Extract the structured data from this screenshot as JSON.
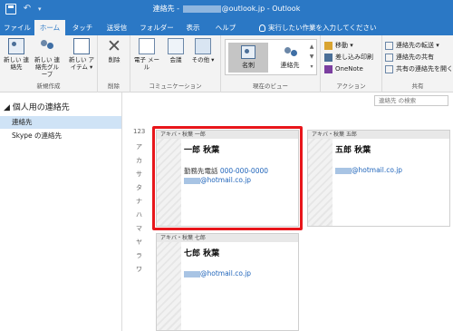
{
  "window": {
    "title_prefix": "連絡先 - ",
    "title_suffix": "@outlook.jp  -  Outlook"
  },
  "tabs": [
    {
      "label": "ファイル",
      "active": false
    },
    {
      "label": "ホーム",
      "active": true
    },
    {
      "label": "タッチ",
      "active": false
    },
    {
      "label": "送受信",
      "active": false
    },
    {
      "label": "フォルダー",
      "active": false
    },
    {
      "label": "表示",
      "active": false
    },
    {
      "label": "ヘルプ",
      "active": false
    }
  ],
  "tell_me": "実行したい作業を入力してください",
  "ribbon": {
    "new_group": {
      "label": "新規作成",
      "new_contact": "新しい 連絡先",
      "new_group": "新しい 連絡先グループ",
      "new_item": "新しい アイテム ▾"
    },
    "delete_group": {
      "label": "削除",
      "delete": "削除"
    },
    "comm_group": {
      "label": "コミュニケーション",
      "email": "電子 メール",
      "meeting": "会議",
      "more": "その他 ▾"
    },
    "view_group": {
      "label": "現在のビュー",
      "business_card": "名刺",
      "contacts": "連絡先"
    },
    "actions_group": {
      "label": "アクション",
      "move": "移動 ▾",
      "mail_merge": "差し込み印刷",
      "onenote": "OneNote"
    },
    "share_group": {
      "label": "共有",
      "forward": "連絡先の転送 ▾",
      "share": "連絡先の共有",
      "open_shared": "共有の連絡先を開く"
    }
  },
  "nav": {
    "title": "個人用の連絡先",
    "items": [
      {
        "label": "連絡先",
        "selected": true
      },
      {
        "label": "Skype の連絡先",
        "selected": false
      }
    ]
  },
  "search": {
    "placeholder": "連絡先 の検索"
  },
  "alphabet": [
    "123",
    "ア",
    "カ",
    "サ",
    "タ",
    "ナ",
    "ハ",
    "マ",
    "ヤ",
    "ラ",
    "ワ"
  ],
  "cards": [
    {
      "header": "アキバ・秋葉 一郎",
      "name": "一郎 秋葉",
      "phone_label": "勤務先電話",
      "phone": "000-000-0000",
      "email": "@hotmail.co.jp"
    },
    {
      "header": "アキバ・秋葉 五郎",
      "name": "五郎 秋葉",
      "email": "@hotmail.co.jp"
    },
    {
      "header": "アキバ・秋葉 七郎",
      "name": "七郎 秋葉",
      "email": "@hotmail.co.jp"
    }
  ],
  "colors": {
    "accent": "#2b78c5",
    "highlight": "#e8161b"
  }
}
